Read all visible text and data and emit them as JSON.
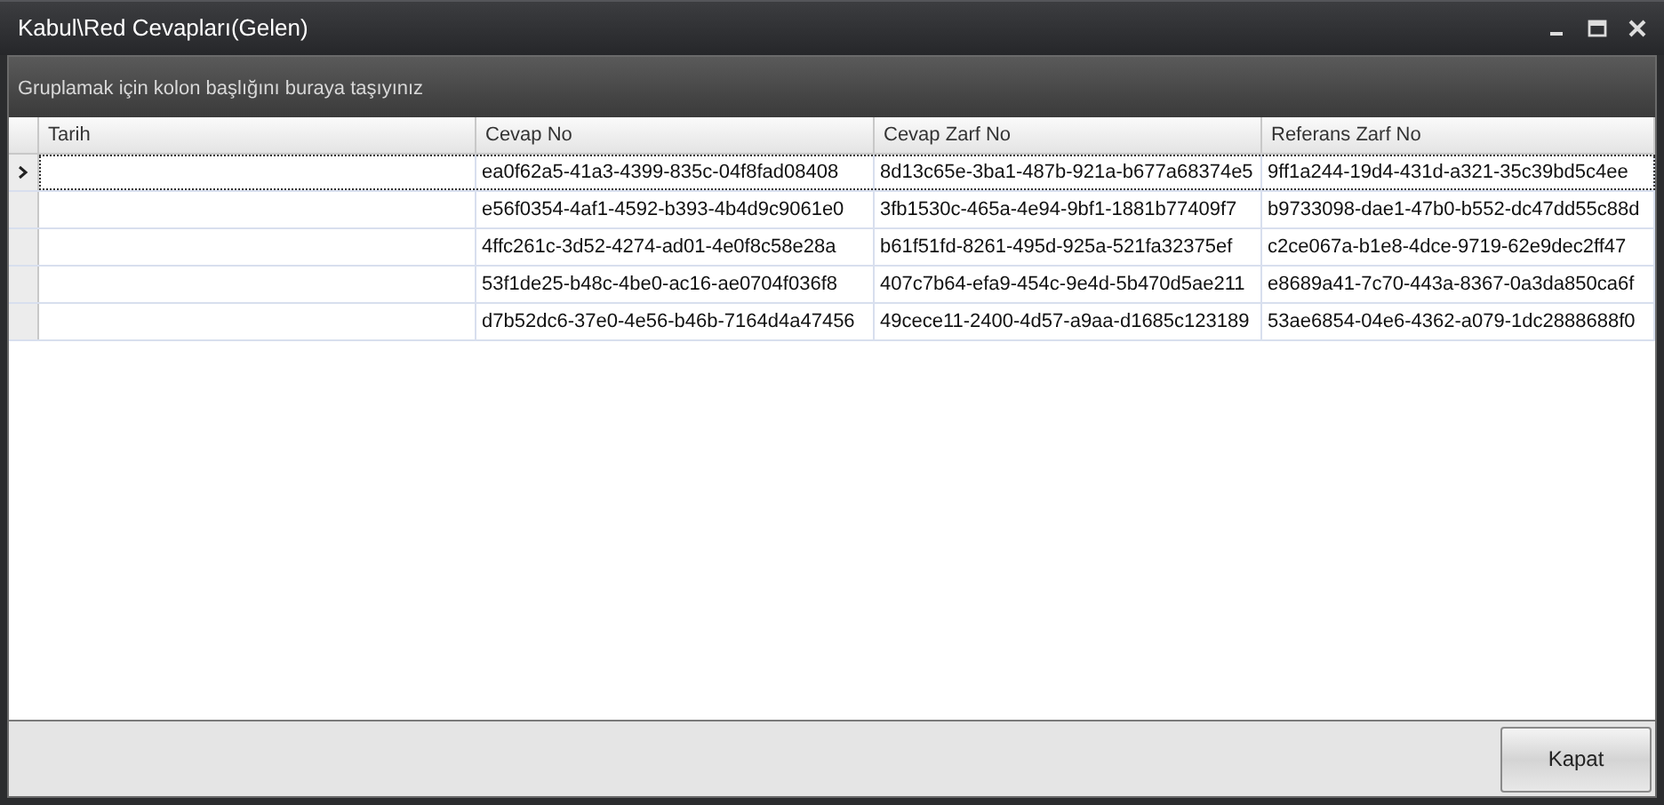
{
  "window": {
    "title": "Kabul\\Red Cevapları(Gelen)"
  },
  "group_panel": {
    "text": "Gruplamak için kolon başlığını buraya taşıyınız"
  },
  "table": {
    "columns": [
      "Tarih",
      "Cevap No",
      "Cevap Zarf No",
      "Referans Zarf No"
    ],
    "rows": [
      {
        "selected": true,
        "cells": [
          "",
          "ea0f62a5-41a3-4399-835c-04f8fad08408",
          "8d13c65e-3ba1-487b-921a-b677a68374e5",
          "9ff1a244-19d4-431d-a321-35c39bd5c4ee"
        ]
      },
      {
        "selected": false,
        "cells": [
          "",
          "e56f0354-4af1-4592-b393-4b4d9c9061e0",
          "3fb1530c-465a-4e94-9bf1-1881b77409f7",
          "b9733098-dae1-47b0-b552-dc47dd55c88d"
        ]
      },
      {
        "selected": false,
        "cells": [
          "",
          "4ffc261c-3d52-4274-ad01-4e0f8c58e28a",
          "b61f51fd-8261-495d-925a-521fa32375ef",
          "c2ce067a-b1e8-4dce-9719-62e9dec2ff47"
        ]
      },
      {
        "selected": false,
        "cells": [
          "",
          "53f1de25-b48c-4be0-ac16-ae0704f036f8",
          "407c7b64-efa9-454c-9e4d-5b470d5ae211",
          "e8689a41-7c70-443a-8367-0a3da850ca6f"
        ]
      },
      {
        "selected": false,
        "cells": [
          "",
          "d7b52dc6-37e0-4e56-b46b-7164d4a47456",
          "49cece11-2400-4d57-a9aa-d1685c123189",
          "53ae6854-04e6-4362-a079-1dc2888688f0"
        ]
      }
    ]
  },
  "buttons": [
    "Kapat"
  ]
}
